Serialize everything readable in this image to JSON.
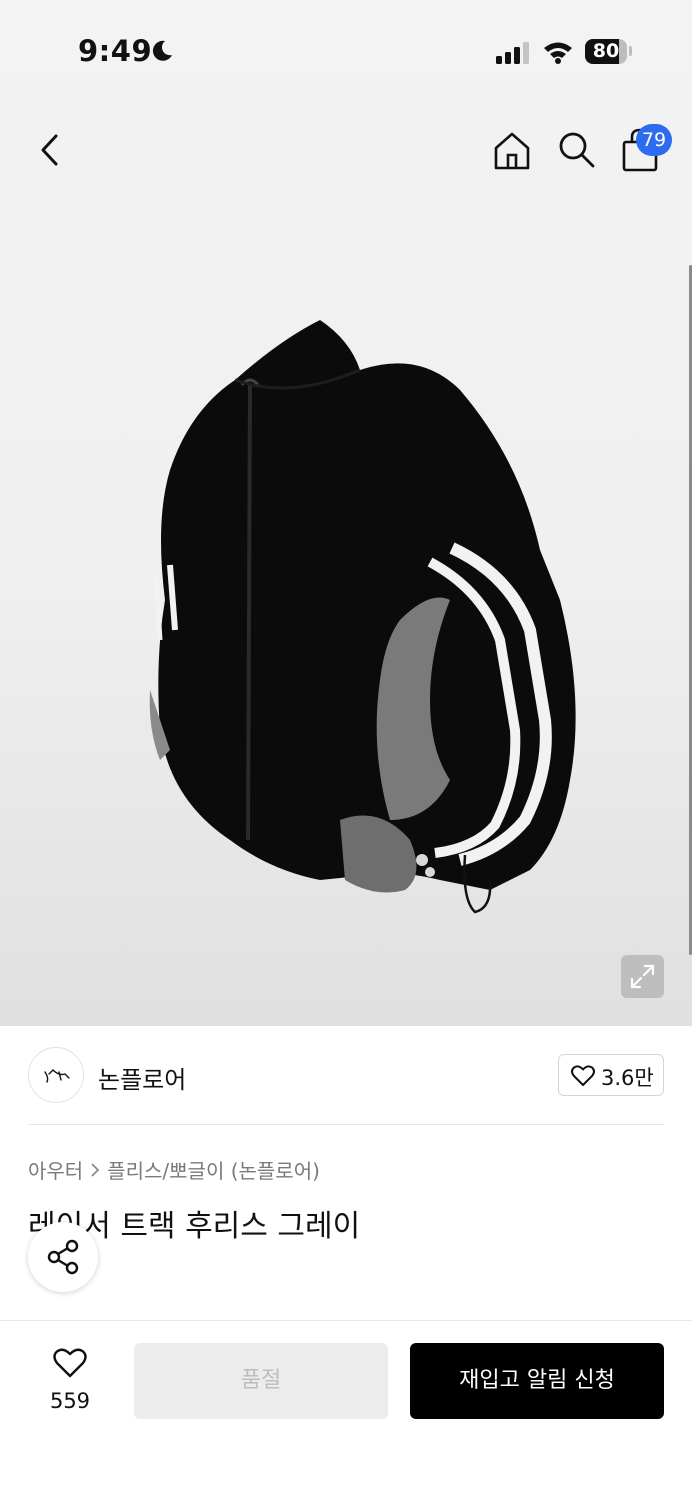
{
  "status_bar": {
    "time": "9:49",
    "battery": "80",
    "battery_level": 0.8,
    "icons": [
      "moon-icon",
      "signal-icon",
      "wifi-icon",
      "battery-icon"
    ]
  },
  "nav": {
    "icons": [
      "chevron-left-icon",
      "home-icon",
      "search-icon",
      "bag-icon"
    ],
    "cart_count": "79"
  },
  "product": {
    "image_alt": "black fleece track jacket with grey lining and white sleeve stripes",
    "brand": "논플로어",
    "brand_likes": "3.6만",
    "breadcrumb": [
      "아우터",
      "플리스/뽀글이 (논플로어)"
    ],
    "title": "레이서 트랙 후리스 그레이"
  },
  "bottom_bar": {
    "likes": "559",
    "soldout_label": "품절",
    "restock_label": "재입고 알림 신청"
  },
  "colors": {
    "badge": "#2d6cf0",
    "primary_button": "#000000",
    "disabled_button": "#ececec"
  }
}
